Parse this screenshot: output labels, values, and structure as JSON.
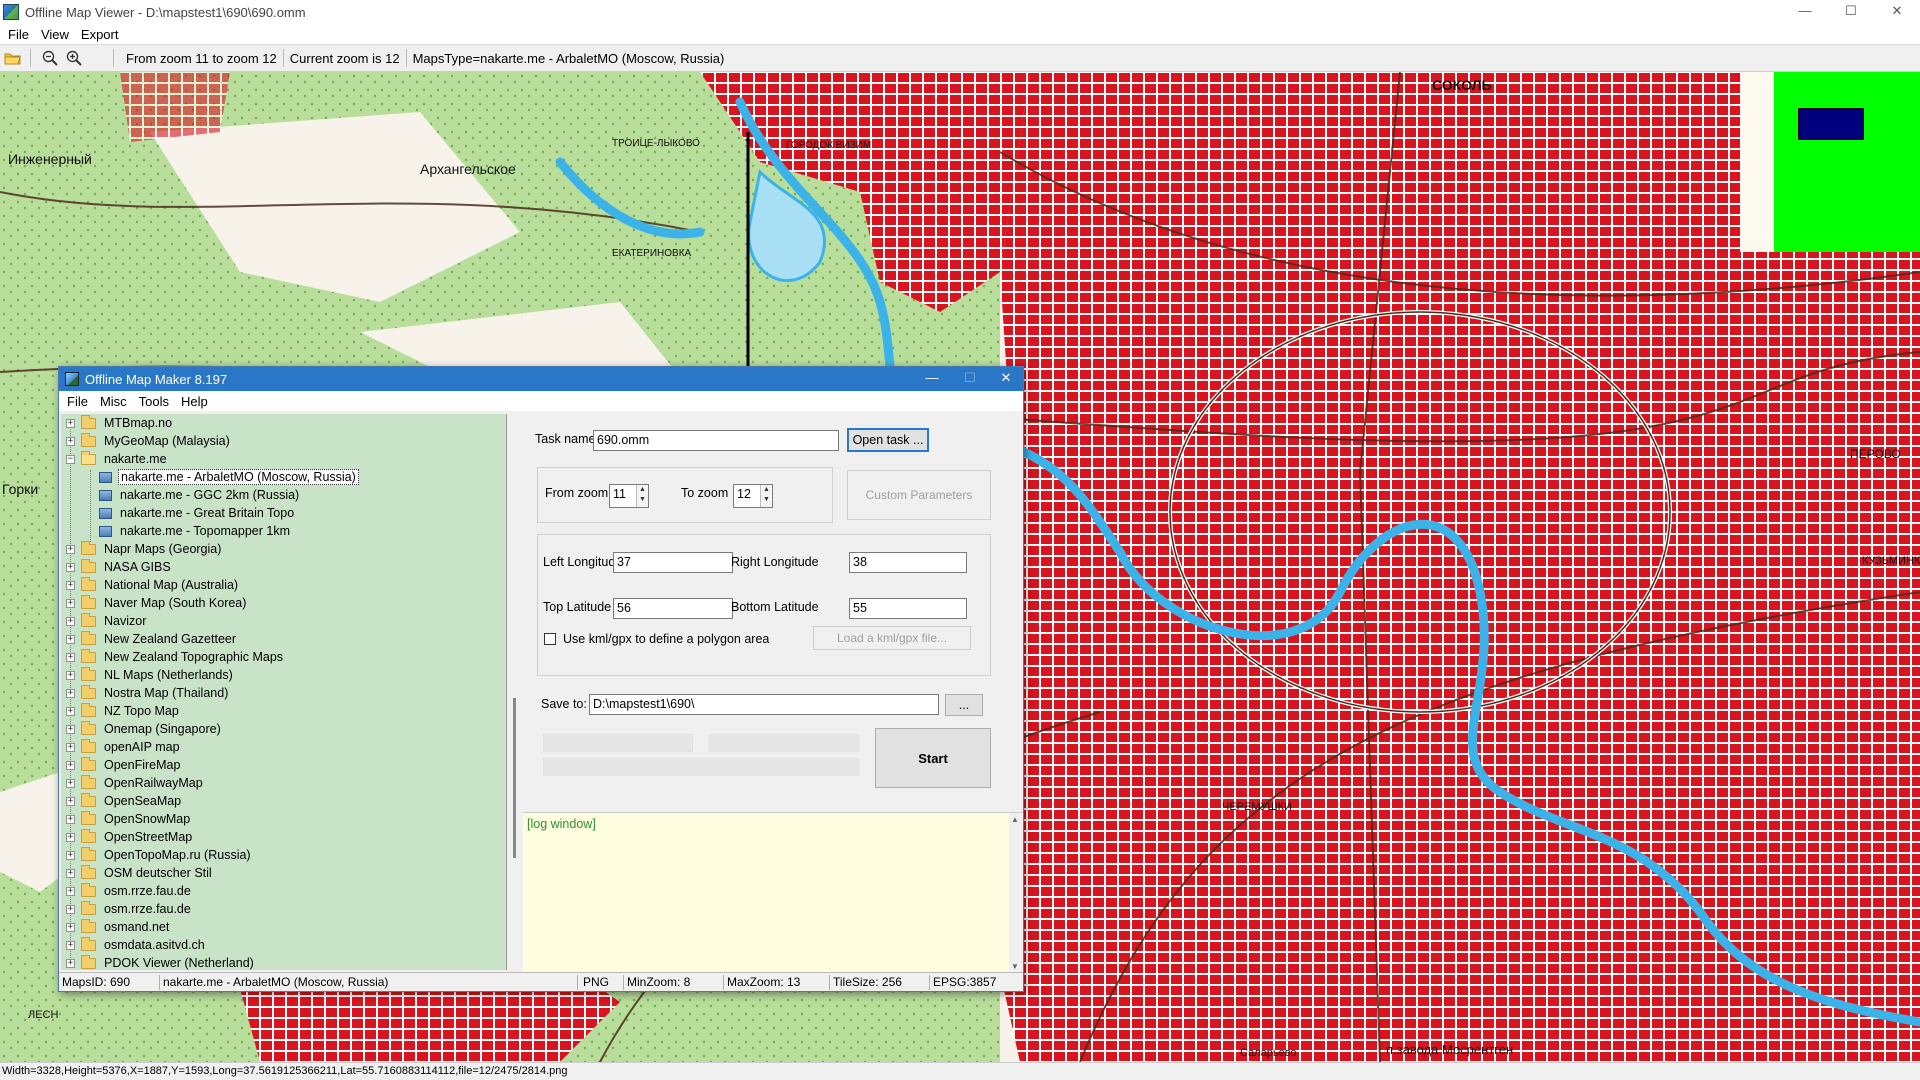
{
  "viewer": {
    "title": "Offline Map Viewer - D:\\mapstest1\\690\\690.omm",
    "window_buttons": {
      "minimize": "—",
      "maximize": "☐",
      "close": "✕"
    },
    "menu": [
      "File",
      "View",
      "Export"
    ],
    "toolbar": {
      "icons": [
        "open-folder-icon",
        "zoom-out-icon",
        "zoom-in-icon"
      ],
      "zoom_range": "From zoom 11 to zoom 12",
      "current_zoom": "Current zoom is 12",
      "maps_type": "MapsType=nakarte.me - ArbaletMO (Moscow, Russia)"
    },
    "status_line": "Width=3328,Height=5376,X=1887,Y=1593,Long=37.5619125366211,Lat=55.7160883114112,file=12/2475/2814.png"
  },
  "map": {
    "colors": {
      "urban": "#d9141f",
      "forest": "#b9dd9b",
      "river": "#3cb3e8",
      "water_fill": "#a8dff5",
      "background": "#f7f3ea"
    },
    "place_labels": [
      "Архангельское",
      "Инженерный",
      "СОКОЛЬ",
      "ПЕРОВО",
      "ГОРОДОК ВИЗИМ",
      "ЧЕРЕМУШКИ",
      "п.завода Мосрентген",
      "Саларьево",
      "ТРОИЦЕ-ЛЫКОВО",
      "ЛЕСН",
      "Горки",
      "КУЗЬМИНКИ",
      "ЕКАТЕРИНОВКА"
    ],
    "overview": {
      "frame_color": "#00ff00",
      "view_color": "#00007f"
    }
  },
  "dialog": {
    "title": "Offline Map Maker 8.197",
    "menu": [
      "File",
      "Misc",
      "Tools",
      "Help"
    ],
    "tree": [
      {
        "label": "MTBmap.no",
        "expanded": false
      },
      {
        "label": "MyGeoMap (Malaysia)",
        "expanded": false
      },
      {
        "label": "nakarte.me",
        "expanded": true,
        "children": [
          {
            "label": "nakarte.me - ArbaletMO (Moscow, Russia)",
            "selected": true
          },
          {
            "label": "nakarte.me - GGC 2km (Russia)"
          },
          {
            "label": "nakarte.me - Great Britain Topo"
          },
          {
            "label": "nakarte.me - Topomapper 1km"
          }
        ]
      },
      {
        "label": "Napr Maps (Georgia)",
        "expanded": false
      },
      {
        "label": "NASA GIBS",
        "expanded": false
      },
      {
        "label": "National Map (Australia)",
        "expanded": false
      },
      {
        "label": "Naver Map (South Korea)",
        "expanded": false
      },
      {
        "label": "Navizor",
        "expanded": false
      },
      {
        "label": "New Zealand Gazetteer",
        "expanded": false
      },
      {
        "label": "New Zealand Topographic Maps",
        "expanded": false
      },
      {
        "label": "NL Maps (Netherlands)",
        "expanded": false
      },
      {
        "label": "Nostra Map (Thailand)",
        "expanded": false
      },
      {
        "label": "NZ Topo Map",
        "expanded": false
      },
      {
        "label": "Onemap (Singapore)",
        "expanded": false
      },
      {
        "label": "openAIP map",
        "expanded": false
      },
      {
        "label": "OpenFireMap",
        "expanded": false
      },
      {
        "label": "OpenRailwayMap",
        "expanded": false
      },
      {
        "label": "OpenSeaMap",
        "expanded": false
      },
      {
        "label": "OpenSnowMap",
        "expanded": false
      },
      {
        "label": "OpenStreetMap",
        "expanded": false
      },
      {
        "label": "OpenTopoMap.ru (Russia)",
        "expanded": false
      },
      {
        "label": "OSM deutscher Stil",
        "expanded": false
      },
      {
        "label": "osm.rrze.fau.de",
        "expanded": false
      },
      {
        "label": "osm.rrze.fau.de",
        "expanded": false
      },
      {
        "label": "osmand.net",
        "expanded": false
      },
      {
        "label": "osmdata.asitvd.ch",
        "expanded": false
      },
      {
        "label": "PDOK Viewer (Netherland)",
        "expanded": false
      }
    ],
    "task": {
      "label": "Task name",
      "value": "690.omm",
      "open_button": "Open task ..."
    },
    "zoom": {
      "from_label": "From zoom",
      "from_value": "11",
      "to_label": "To zoom",
      "to_value": "12",
      "custom_button": "Custom Parameters"
    },
    "area": {
      "left_lon_label": "Left Longitude",
      "left_lon": "37",
      "right_lon_label": "Right Longitude",
      "right_lon": "38",
      "top_lat_label": "Top Latitude",
      "top_lat": "56",
      "bottom_lat_label": "Bottom Latitude",
      "bottom_lat": "55",
      "polygon_check_label": "Use kml/gpx to define a polygon area",
      "polygon_checked": false,
      "load_kml_button": "Load a kml/gpx file..."
    },
    "save": {
      "label": "Save to:",
      "value": "D:\\mapstest1\\690\\",
      "browse_button": "..."
    },
    "progress": [
      0,
      0,
      0
    ],
    "start_button": "Start",
    "log_text": "[log window]",
    "status": {
      "maps_id": "MapsID: 690",
      "map_name": "nakarte.me - ArbaletMO (Moscow, Russia)",
      "format": "PNG",
      "min_zoom": "MinZoom: 8",
      "max_zoom": "MaxZoom: 13",
      "tile_size": "TileSize: 256",
      "epsg": "EPSG:3857"
    }
  }
}
